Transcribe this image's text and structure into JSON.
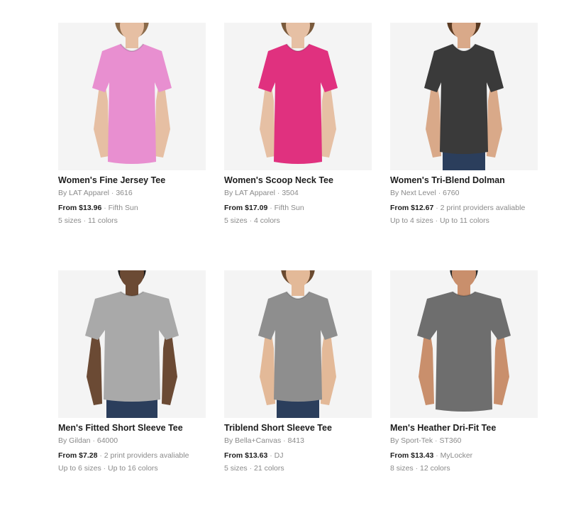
{
  "separator": " · ",
  "products": [
    {
      "title": "Women's Fine Jersey Tee",
      "brand": "By LAT Apparel",
      "model": "3616",
      "price": "From $13.96",
      "provider": "Fifth Sun",
      "sizes": "5 sizes",
      "colors": "11 colors",
      "shirt_color": "#e88fd0",
      "skin_color": "#e6bfa3",
      "hair_color": "#8a6a4a",
      "figure": "woman"
    },
    {
      "title": "Women's Scoop Neck Tee",
      "brand": "By LAT Apparel",
      "model": "3504",
      "price": "From $17.09",
      "provider": "Fifth Sun",
      "sizes": "5 sizes",
      "colors": "4 colors",
      "shirt_color": "#e0317f",
      "skin_color": "#e6c0a4",
      "hair_color": "#7a5a3c",
      "figure": "woman"
    },
    {
      "title": "Women's Tri-Blend Dolman",
      "brand": "By Next Level",
      "model": "6760",
      "price": "From $12.67",
      "provider": "2 print providers avaliable",
      "sizes": "Up to 4 sizes",
      "colors": "Up to 11 colors",
      "shirt_color": "#3a3a3a",
      "skin_color": "#d9a989",
      "hair_color": "#5a3a22",
      "figure": "woman-jeans"
    },
    {
      "title": "Men's Fitted Short Sleeve Tee",
      "brand": "By Gildan",
      "model": "64000",
      "price": "From $7.28",
      "provider": "2 print providers avaliable",
      "sizes": "Up to 6 sizes",
      "colors": "Up to 16 colors",
      "shirt_color": "#a9a9a9",
      "skin_color": "#6b4a34",
      "hair_color": "#1a1a1a",
      "figure": "man-jeans"
    },
    {
      "title": "Triblend Short Sleeve Tee",
      "brand": "By Bella+Canvas",
      "model": "8413",
      "price": "From $13.63",
      "provider": "DJ",
      "sizes": "5 sizes",
      "colors": "21 colors",
      "shirt_color": "#8e8e8e",
      "skin_color": "#e3b998",
      "hair_color": "#6a4a30",
      "figure": "woman-jeans"
    },
    {
      "title": "Men's Heather Dri-Fit Tee",
      "brand": "By Sport-Tek",
      "model": "ST360",
      "price": "From $13.43",
      "provider": "MyLocker",
      "sizes": "8 sizes",
      "colors": "12 colors",
      "shirt_color": "#6e6e6e",
      "skin_color": "#c98f6c",
      "hair_color": "#2a2a2a",
      "figure": "man-dark"
    }
  ]
}
